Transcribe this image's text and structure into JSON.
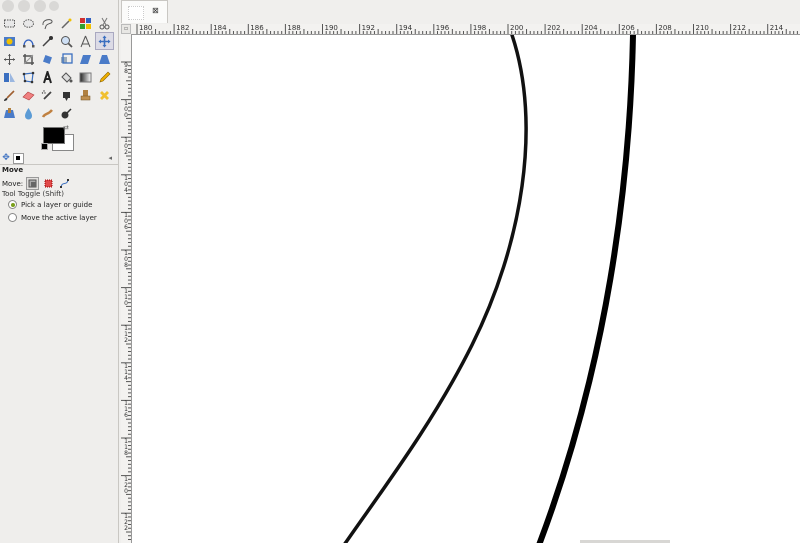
{
  "image_tab": {
    "close_label": "⊠"
  },
  "tools": [
    "rect-select-icon",
    "ellipse-select-icon",
    "free-select-icon",
    "fuzzy-select-icon",
    "select-by-color-icon",
    "scissors-icon",
    "foreground-select-icon",
    "paths-icon",
    "color-picker-icon",
    "zoom-icon",
    "measure-icon",
    "move-icon",
    "align-icon",
    "crop-icon",
    "rotate-icon",
    "scale-icon",
    "shear-icon",
    "perspective-icon",
    "flip-icon",
    "cage-transform-icon",
    "text-icon",
    "bucket-fill-icon",
    "blend-icon",
    "pencil-icon",
    "paintbrush-icon",
    "eraser-icon",
    "airbrush-icon",
    "ink-icon",
    "clone-icon",
    "heal-icon",
    "perspective-clone-icon",
    "blur-icon",
    "smudge-icon",
    "dodge-burn-icon"
  ],
  "active_tool": "move-icon",
  "colors": {
    "foreground": "#000000",
    "background": "#ffffff"
  },
  "tool_options": {
    "title": "Move",
    "move_label": "Move:",
    "toggle_label": "Tool Toggle  (Shift)",
    "radio_pick": "Pick a layer or guide",
    "radio_move": "Move the active layer",
    "selected": "Pick a layer or guide"
  },
  "rulers": {
    "horizontal": [
      "180",
      "182",
      "184",
      "186",
      "188",
      "190",
      "192",
      "194",
      "196",
      "198",
      "200",
      "202",
      "204",
      "206",
      "208",
      "210",
      "212",
      "214"
    ],
    "vertical": [
      "9\n8",
      "1\n0\n0",
      "1\n0\n2",
      "1\n0\n4",
      "1\n0\n6",
      "1\n0\n8",
      "1\n1\n0",
      "1\n1\n2",
      "1\n1\n4",
      "1\n1\n6",
      "1\n1\n8",
      "1\n2\n0",
      "1\n2\n2"
    ]
  }
}
